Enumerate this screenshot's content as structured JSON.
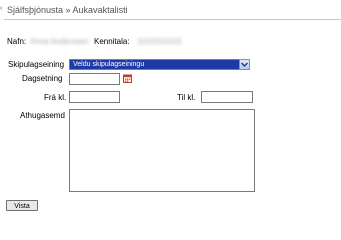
{
  "header": {
    "edge_mark": "‹",
    "title": "Sjálfsþjónusta » Aukavaktalisti"
  },
  "user": {
    "name_label": "Nafn:",
    "name_value": "Anna Anderssen",
    "id_label": "Kennitala:",
    "id_value": "1010101010"
  },
  "form": {
    "unit_label": "Skipulagseining",
    "unit_selected": "Veldu skipulagseiningu",
    "date_label": "Dagsetning",
    "from_label": "Frá kl.",
    "to_label": "Til kl.",
    "comment_label": "Athugasemd",
    "date_value": "",
    "from_value": "",
    "to_value": "",
    "comment_value": "",
    "submit_label": "Vista"
  },
  "colors": {
    "select_bg": "#1f3aa7",
    "calendar_accent": "#c23b2a"
  },
  "icons": [
    "chevron-down-icon",
    "calendar-icon"
  ]
}
